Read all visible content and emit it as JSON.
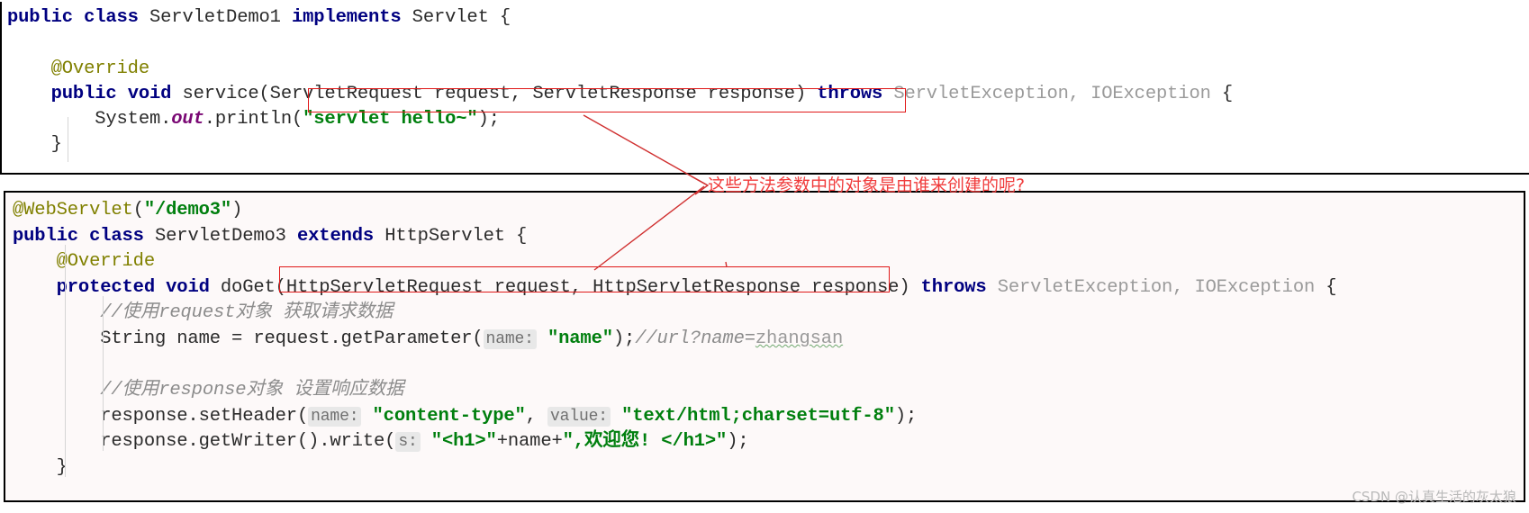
{
  "annotation": {
    "note_text": "这些方法参数中的对象是由谁来创建的呢?",
    "note_color": "#f03b3b",
    "box_color": "#e01818",
    "arrow_color": "#d03030"
  },
  "watermark": {
    "text": "CSDN @认真生活的灰太狼",
    "color": "#b9b9b9"
  },
  "colors": {
    "keyword": "#000080",
    "string": "#007F0E",
    "annotation": "#808000",
    "comment": "#8c8c8c",
    "static_field": "#7a0874",
    "dim_type": "#9a9a9a",
    "hint_bg": "#e8e8e8",
    "panel_top_bg": "#ffffff",
    "panel_bottom_bg": "#fdf9f9"
  },
  "top_panel": {
    "name": "ServletDemo1",
    "lines": [
      {
        "tokens": [
          {
            "t": "public",
            "c": "kw"
          },
          {
            "t": " ",
            "c": "plain"
          },
          {
            "t": "class",
            "c": "kw"
          },
          {
            "t": " ServletDemo1 ",
            "c": "plain"
          },
          {
            "t": "implements",
            "c": "kw"
          },
          {
            "t": " Servlet {",
            "c": "plain"
          }
        ]
      },
      {
        "tokens": []
      },
      {
        "tokens": [
          {
            "t": "    @Override",
            "c": "anno"
          }
        ]
      },
      {
        "tokens": [
          {
            "t": "    ",
            "c": "plain"
          },
          {
            "t": "public",
            "c": "kw"
          },
          {
            "t": " ",
            "c": "plain"
          },
          {
            "t": "void",
            "c": "kw"
          },
          {
            "t": " service(ServletRequest request, ServletResponse response) ",
            "c": "plain"
          },
          {
            "t": "throws",
            "c": "kw"
          },
          {
            "t": " ServletException, IOException",
            "c": "dim"
          },
          {
            "t": " {",
            "c": "plain"
          }
        ]
      },
      {
        "tokens": [
          {
            "t": "        System.",
            "c": "plain"
          },
          {
            "t": "out",
            "c": "field"
          },
          {
            "t": ".println(",
            "c": "plain"
          },
          {
            "t": "\"servlet hello~\"",
            "c": "str"
          },
          {
            "t": ");",
            "c": "plain"
          }
        ]
      },
      {
        "tokens": [
          {
            "t": "    }",
            "c": "plain"
          }
        ]
      }
    ]
  },
  "bottom_panel": {
    "name": "ServletDemo3",
    "lines": [
      {
        "tokens": [
          {
            "t": "@WebServlet",
            "c": "anno"
          },
          {
            "t": "(",
            "c": "plain"
          },
          {
            "t": "\"/demo3\"",
            "c": "str"
          },
          {
            "t": ")",
            "c": "plain"
          }
        ]
      },
      {
        "tokens": [
          {
            "t": "public",
            "c": "kw"
          },
          {
            "t": " ",
            "c": "plain"
          },
          {
            "t": "class",
            "c": "kw"
          },
          {
            "t": " ServletDemo3 ",
            "c": "plain"
          },
          {
            "t": "extends",
            "c": "kw"
          },
          {
            "t": " HttpServlet {",
            "c": "plain"
          }
        ]
      },
      {
        "tokens": [
          {
            "t": "    @Override",
            "c": "anno"
          }
        ]
      },
      {
        "tokens": [
          {
            "t": "    ",
            "c": "plain"
          },
          {
            "t": "protected",
            "c": "kw"
          },
          {
            "t": " ",
            "c": "plain"
          },
          {
            "t": "void",
            "c": "kw"
          },
          {
            "t": " doGet(HttpServletRequest request, HttpServletResponse response) ",
            "c": "plain"
          },
          {
            "t": "throws",
            "c": "kw"
          },
          {
            "t": " ServletException, IOException",
            "c": "dim"
          },
          {
            "t": " {",
            "c": "plain"
          }
        ]
      },
      {
        "tokens": [
          {
            "t": "        //使用request对象 获取请求数据",
            "c": "cmt"
          }
        ]
      },
      {
        "tokens": [
          {
            "t": "        String name = request.getParameter(",
            "c": "plain"
          },
          {
            "t": "name:",
            "c": "hint"
          },
          {
            "t": " ",
            "c": "plain"
          },
          {
            "t": "\"name\"",
            "c": "str"
          },
          {
            "t": ");",
            "c": "plain"
          },
          {
            "t": "//url?name=",
            "c": "cmt"
          },
          {
            "t": "zhangsan",
            "c": "wavy"
          }
        ]
      },
      {
        "tokens": []
      },
      {
        "tokens": [
          {
            "t": "        //使用response对象 设置响应数据",
            "c": "cmt"
          }
        ]
      },
      {
        "tokens": [
          {
            "t": "        response.setHeader(",
            "c": "plain"
          },
          {
            "t": "name:",
            "c": "hint"
          },
          {
            "t": " ",
            "c": "plain"
          },
          {
            "t": "\"content-type\"",
            "c": "str"
          },
          {
            "t": ", ",
            "c": "plain"
          },
          {
            "t": "value:",
            "c": "hint"
          },
          {
            "t": " ",
            "c": "plain"
          },
          {
            "t": "\"text/html;charset=utf-8\"",
            "c": "str"
          },
          {
            "t": ");",
            "c": "plain"
          }
        ]
      },
      {
        "tokens": [
          {
            "t": "        response.getWriter().write(",
            "c": "plain"
          },
          {
            "t": "s:",
            "c": "hint"
          },
          {
            "t": " ",
            "c": "plain"
          },
          {
            "t": "\"<h1>\"",
            "c": "str"
          },
          {
            "t": "+name+",
            "c": "plain"
          },
          {
            "t": "\",欢迎您! </h1>\"",
            "c": "str"
          },
          {
            "t": ");",
            "c": "plain"
          }
        ]
      },
      {
        "tokens": [
          {
            "t": "    }",
            "c": "plain"
          }
        ]
      }
    ]
  }
}
